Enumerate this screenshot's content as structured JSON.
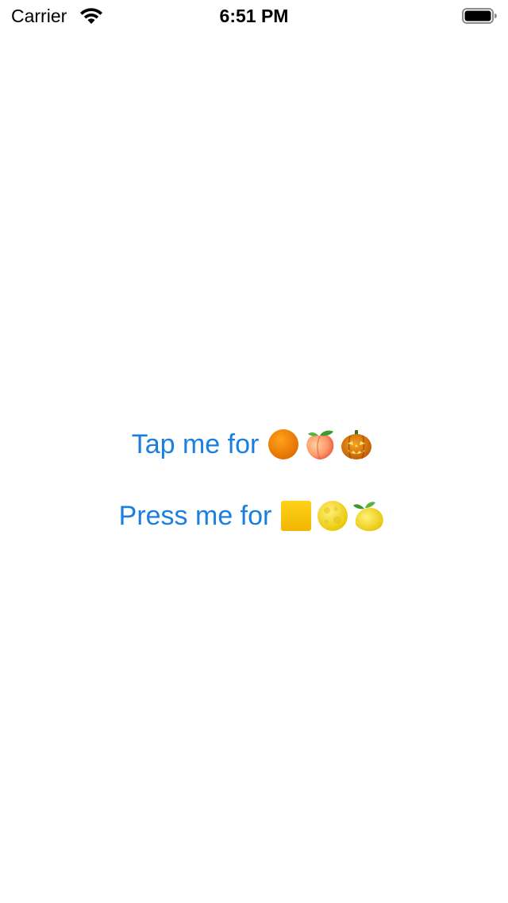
{
  "status_bar": {
    "carrier": "Carrier",
    "time": "6:51 PM"
  },
  "buttons": {
    "tap": {
      "label": "Tap me for",
      "icons": [
        "orange-circle-icon",
        "peach-icon",
        "jack-o-lantern-icon"
      ]
    },
    "press": {
      "label": "Press me for",
      "icons": [
        "yellow-square-icon",
        "full-moon-icon",
        "lemon-icon"
      ]
    }
  },
  "colors": {
    "link_blue": "#1a7fe0",
    "background": "#ffffff"
  }
}
